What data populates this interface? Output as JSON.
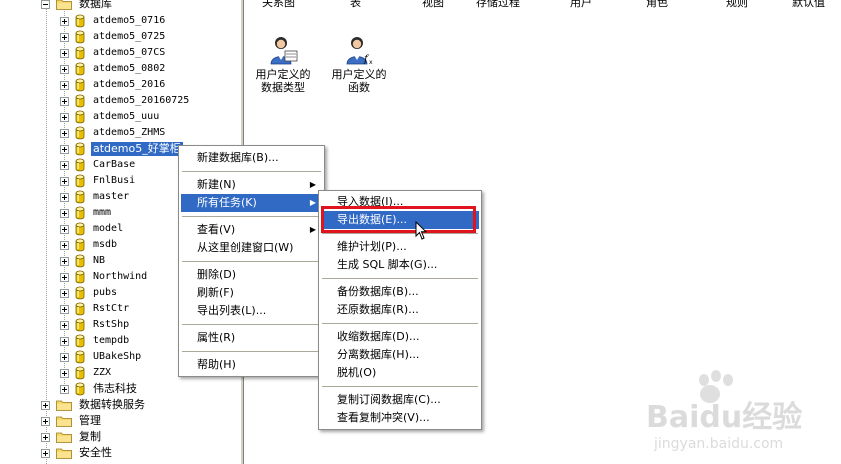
{
  "tree": {
    "root_label": "数据库",
    "databases": [
      "atdemo5_0716",
      "atdemo5_0725",
      "atdemo5_07CS",
      "atdemo5_0802",
      "atdemo5_2016",
      "atdemo5_20160725",
      "atdemo5_uuu",
      "atdemo5_ZHMS",
      "atdemo5_好掌柜",
      "CarBase",
      "FnlBusi",
      "master",
      "mmm",
      "model",
      "msdb",
      "NB",
      "Northwind",
      "pubs",
      "RstCtr",
      "RstShp",
      "tempdb",
      "UBakeShp",
      "ZZX",
      "伟志科技"
    ],
    "selected_index": 8,
    "top_nodes": [
      "数据转换服务",
      "管理",
      "复制",
      "安全性"
    ]
  },
  "right_pane": {
    "column_headers": [
      "关系图",
      "表",
      "视图",
      "存储过程",
      "用户",
      "角色",
      "规则",
      "默认值"
    ],
    "icons": [
      {
        "name": "udt-icon",
        "line1": "用户定义的",
        "line2": "数据类型"
      },
      {
        "name": "udf-icon",
        "line1": "用户定义的",
        "line2": "函数"
      }
    ]
  },
  "context_menu": {
    "items": [
      {
        "label": "新建数据库(B)...",
        "submenu": false
      },
      {
        "sep": true
      },
      {
        "label": "新建(N)",
        "submenu": true
      },
      {
        "label": "所有任务(K)",
        "submenu": true,
        "highlight": true
      },
      {
        "sep": true
      },
      {
        "label": "查看(V)",
        "submenu": true
      },
      {
        "label": "从这里创建窗口(W)",
        "submenu": false
      },
      {
        "sep": true
      },
      {
        "label": "删除(D)",
        "submenu": false
      },
      {
        "label": "刷新(F)",
        "submenu": false
      },
      {
        "label": "导出列表(L)...",
        "submenu": false
      },
      {
        "sep": true
      },
      {
        "label": "属性(R)",
        "submenu": false
      },
      {
        "sep": true
      },
      {
        "label": "帮助(H)",
        "submenu": false
      }
    ]
  },
  "submenu": {
    "items": [
      {
        "label": "导入数据(I)..."
      },
      {
        "label": "导出数据(E)...",
        "highlight": true
      },
      {
        "sep": true
      },
      {
        "label": "维护计划(P)..."
      },
      {
        "label": "生成 SQL 脚本(G)..."
      },
      {
        "sep": true
      },
      {
        "label": "备份数据库(B)..."
      },
      {
        "label": "还原数据库(R)..."
      },
      {
        "sep": true
      },
      {
        "label": "收缩数据库(D)..."
      },
      {
        "label": "分离数据库(H)..."
      },
      {
        "label": "脱机(O)"
      },
      {
        "sep": true
      },
      {
        "label": "复制订阅数据库(C)..."
      },
      {
        "label": "查看复制冲突(V)..."
      }
    ]
  },
  "watermark": {
    "brand": "Baidu经验",
    "domain": "jingyan.baidu.com"
  },
  "colors": {
    "selection": "#316ac5",
    "highlight_box": "#e0141e",
    "db_icon": "#e8c000"
  }
}
